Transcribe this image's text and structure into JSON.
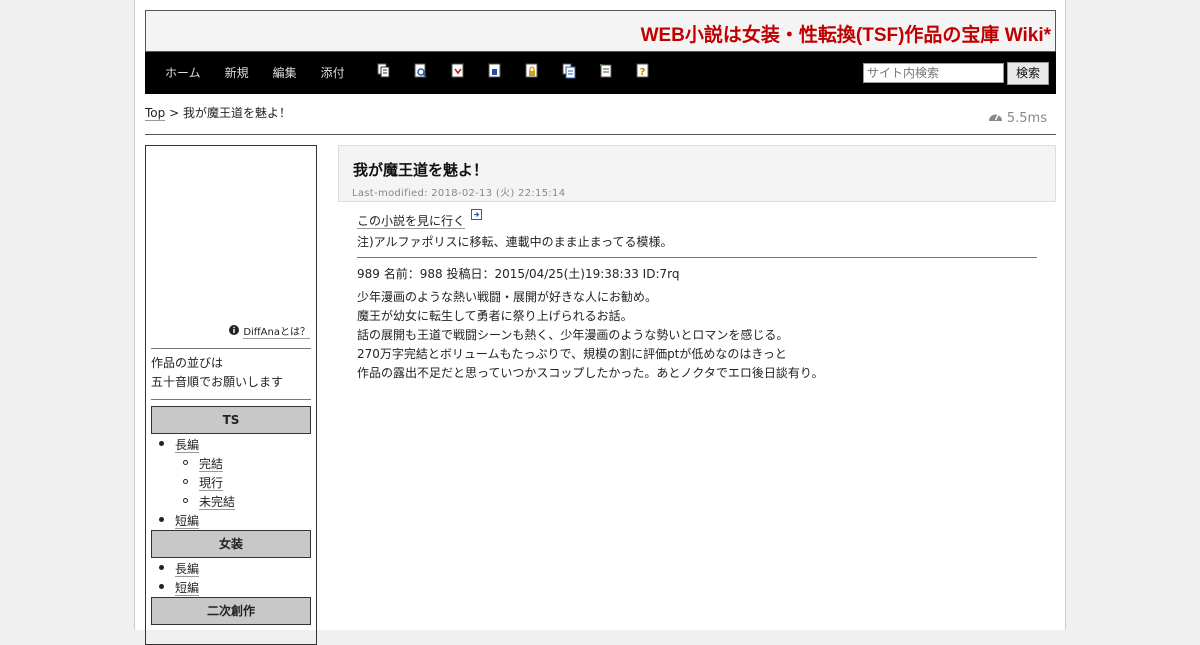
{
  "site": {
    "title": "WEB小説は女装・性転換(TSF)作品の宝庫 Wiki*"
  },
  "nav": {
    "links": [
      "ホーム",
      "新規",
      "編集",
      "添付"
    ],
    "icons": [
      "page-copy-icon",
      "page-search-icon",
      "page-diff-icon",
      "page-save-icon",
      "page-lock-icon",
      "page-list-icon",
      "page-new-icon",
      "help-icon"
    ]
  },
  "search": {
    "placeholder": "サイト内検索",
    "button": "検索"
  },
  "breadcrumb": {
    "top": "Top",
    "sep": " > ",
    "current": "我が魔王道を魅よ！"
  },
  "timer": {
    "value": "5.5ms"
  },
  "sidebar": {
    "diffana": "DiffAnaとは？",
    "note": [
      "作品の並びは",
      "五十音順でお願いします"
    ],
    "sections": [
      {
        "title": "TS",
        "items": [
          {
            "label": "長編",
            "level": 1
          },
          {
            "label": "完結",
            "level": 2
          },
          {
            "label": "現行",
            "level": 2
          },
          {
            "label": "未完結",
            "level": 2
          },
          {
            "label": "短編",
            "level": 1
          }
        ]
      },
      {
        "title": "女装",
        "items": [
          {
            "label": "長編",
            "level": 1
          },
          {
            "label": "短編",
            "level": 1
          }
        ]
      },
      {
        "title": "二次創作",
        "items": []
      }
    ]
  },
  "article": {
    "title": "我が魔王道を魅よ！",
    "last_modified": "Last-modified: 2018-02-13 (火) 22:15:14",
    "visit_link": "この小説を見に行く",
    "note": "注)アルファポリスに移転、連載中のまま止まってる模様。",
    "post_header": "989 名前：988 投稿日：2015/04/25(土)19:38:33 ID:7rq",
    "body": [
      "少年漫画のような熱い戦闘・展開が好きな人にお勧め。",
      "魔王が幼女に転生して勇者に祭り上げられるお話。",
      "話の展開も王道で戦闘シーンも熱く、少年漫画のような勢いとロマンを感じる。",
      "270万字完結とボリュームもたっぷりで、規模の割に評価ptが低めなのはきっと",
      "作品の露出不足だと思っていつかスコップしたかった。あとノクタでエロ後日談有り。"
    ]
  },
  "colors": {
    "title_red": "#c00000",
    "nav_bg": "#000000",
    "header_bg": "#f4f4f4",
    "side_head_bg": "#c8c8c8"
  }
}
